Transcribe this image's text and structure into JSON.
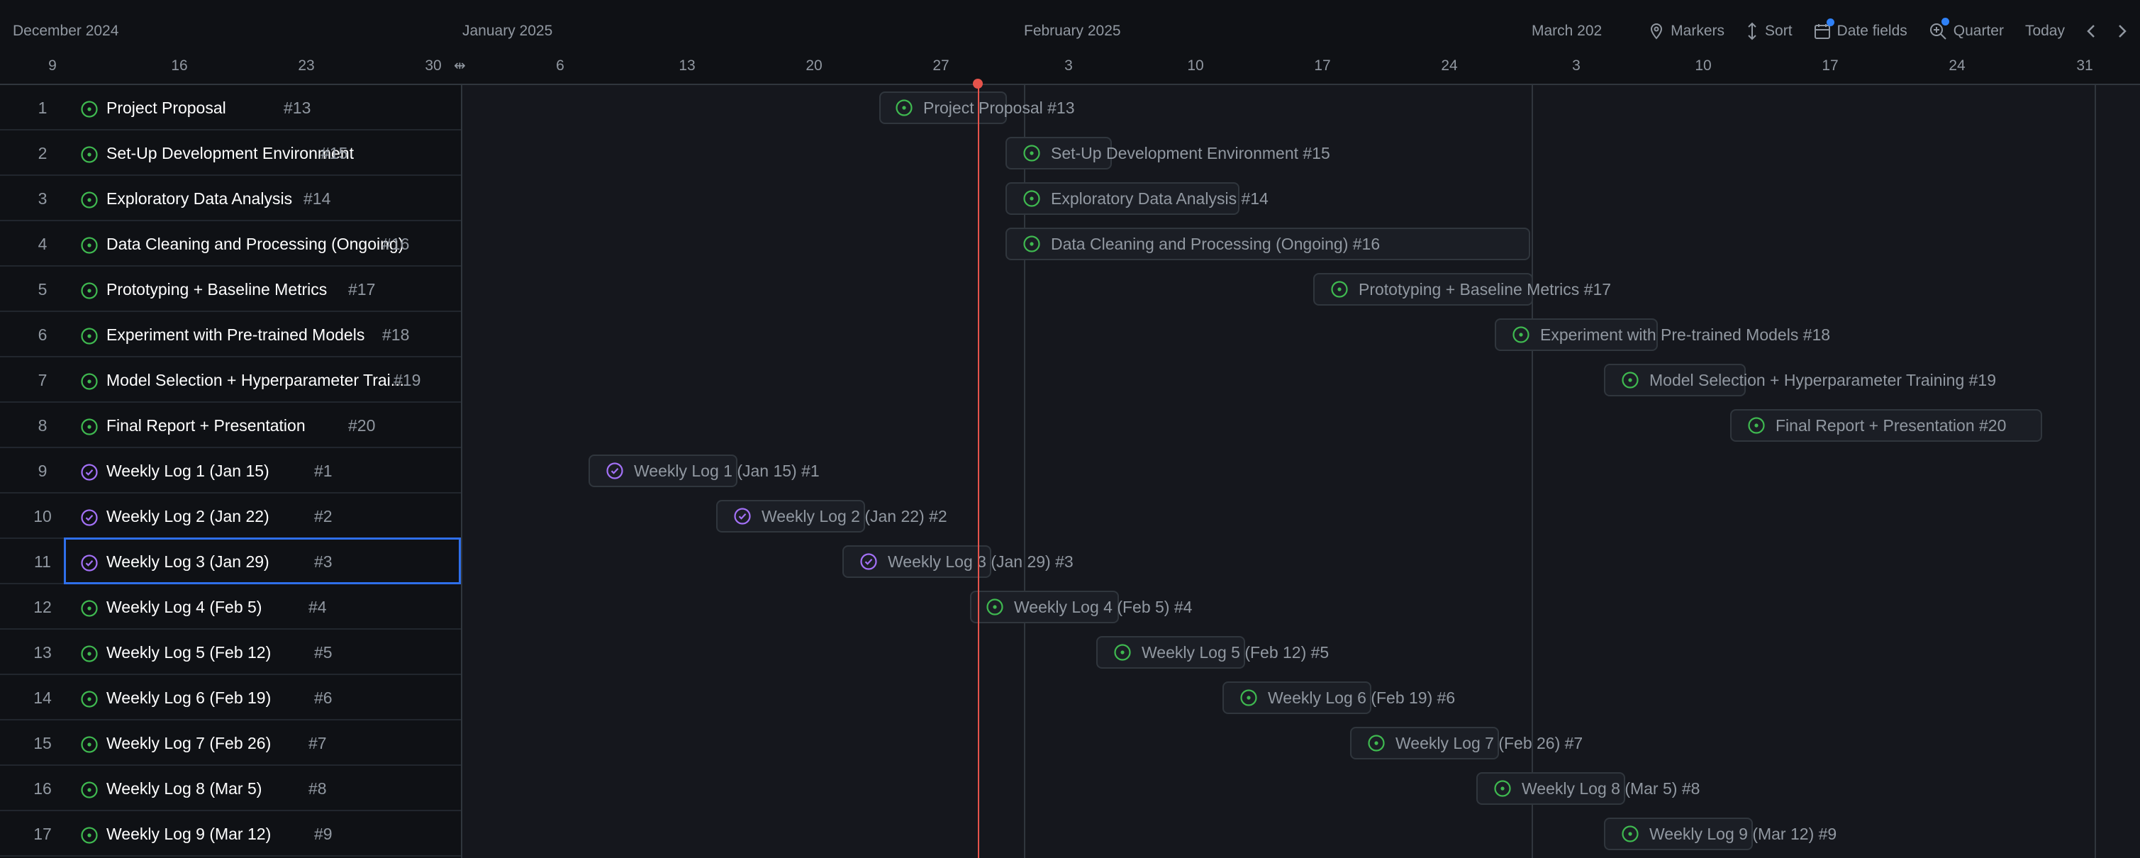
{
  "header": {
    "months": [
      {
        "label": "December 2024"
      },
      {
        "label": "January 2025"
      },
      {
        "label": "February 2025"
      },
      {
        "label": "March 202"
      }
    ],
    "days": [
      "9",
      "16",
      "23",
      "30",
      "6",
      "13",
      "20",
      "27",
      "3",
      "10",
      "17",
      "24",
      "3",
      "10",
      "17",
      "24",
      "31"
    ]
  },
  "toolbar": {
    "markers": "Markers",
    "sort": "Sort",
    "date_fields": "Date fields",
    "zoom": "Quarter",
    "today": "Today"
  },
  "colors": {
    "open": "#3fb950",
    "closed": "#a371f7",
    "today_line": "#e5534b",
    "selection": "#2f6fea",
    "badge": "#2f81f7"
  },
  "rows": [
    {
      "n": "1",
      "title": "Project Proposal",
      "num": "#13",
      "status": "open",
      "bar_label": "Project Proposal #13"
    },
    {
      "n": "2",
      "title": "Set-Up Development Environment",
      "num": "#15",
      "status": "open",
      "bar_label": "Set-Up Development Environment #15"
    },
    {
      "n": "3",
      "title": "Exploratory Data Analysis",
      "num": "#14",
      "status": "open",
      "bar_label": "Exploratory Data Analysis #14"
    },
    {
      "n": "4",
      "title": "Data Cleaning and Processing (Ongoing)",
      "num": "#16",
      "status": "open",
      "bar_label": "Data Cleaning and Processing (Ongoing) #16"
    },
    {
      "n": "5",
      "title": "Prototyping + Baseline Metrics",
      "num": "#17",
      "status": "open",
      "bar_label": "Prototyping + Baseline Metrics #17"
    },
    {
      "n": "6",
      "title": "Experiment with Pre-trained Models",
      "num": "#18",
      "status": "open",
      "bar_label": "Experiment with Pre-trained Models #18"
    },
    {
      "n": "7",
      "title": "Model Selection + Hyperparameter Trai...",
      "num": "#19",
      "status": "open",
      "bar_label": "Model Selection + Hyperparameter Training #19"
    },
    {
      "n": "8",
      "title": "Final Report + Presentation",
      "num": "#20",
      "status": "open",
      "bar_label": "Final Report + Presentation #20"
    },
    {
      "n": "9",
      "title": "Weekly Log 1 (Jan 15)",
      "num": "#1",
      "status": "closed",
      "bar_label": "Weekly Log 1 (Jan 15) #1"
    },
    {
      "n": "10",
      "title": "Weekly Log 2 (Jan 22)",
      "num": "#2",
      "status": "closed",
      "bar_label": "Weekly Log 2 (Jan 22) #2"
    },
    {
      "n": "11",
      "title": "Weekly Log 3 (Jan 29)",
      "num": "#3",
      "status": "closed",
      "bar_label": "Weekly Log 3 (Jan 29) #3",
      "selected": true
    },
    {
      "n": "12",
      "title": "Weekly Log 4 (Feb 5)",
      "num": "#4",
      "status": "open",
      "bar_label": "Weekly Log 4 (Feb 5) #4"
    },
    {
      "n": "13",
      "title": "Weekly Log 5 (Feb 12)",
      "num": "#5",
      "status": "open",
      "bar_label": "Weekly Log 5 (Feb 12) #5"
    },
    {
      "n": "14",
      "title": "Weekly Log 6 (Feb 19)",
      "num": "#6",
      "status": "open",
      "bar_label": "Weekly Log 6 (Feb 19) #6"
    },
    {
      "n": "15",
      "title": "Weekly Log 7 (Feb 26)",
      "num": "#7",
      "status": "open",
      "bar_label": "Weekly Log 7 (Feb 26) #7"
    },
    {
      "n": "16",
      "title": "Weekly Log 8 (Mar 5)",
      "num": "#8",
      "status": "open",
      "bar_label": "Weekly Log 8 (Mar 5) #8"
    },
    {
      "n": "17",
      "title": "Weekly Log 9 (Mar 12)",
      "num": "#9",
      "status": "open",
      "bar_label": "Weekly Log 9 (Mar 12) #9"
    }
  ]
}
